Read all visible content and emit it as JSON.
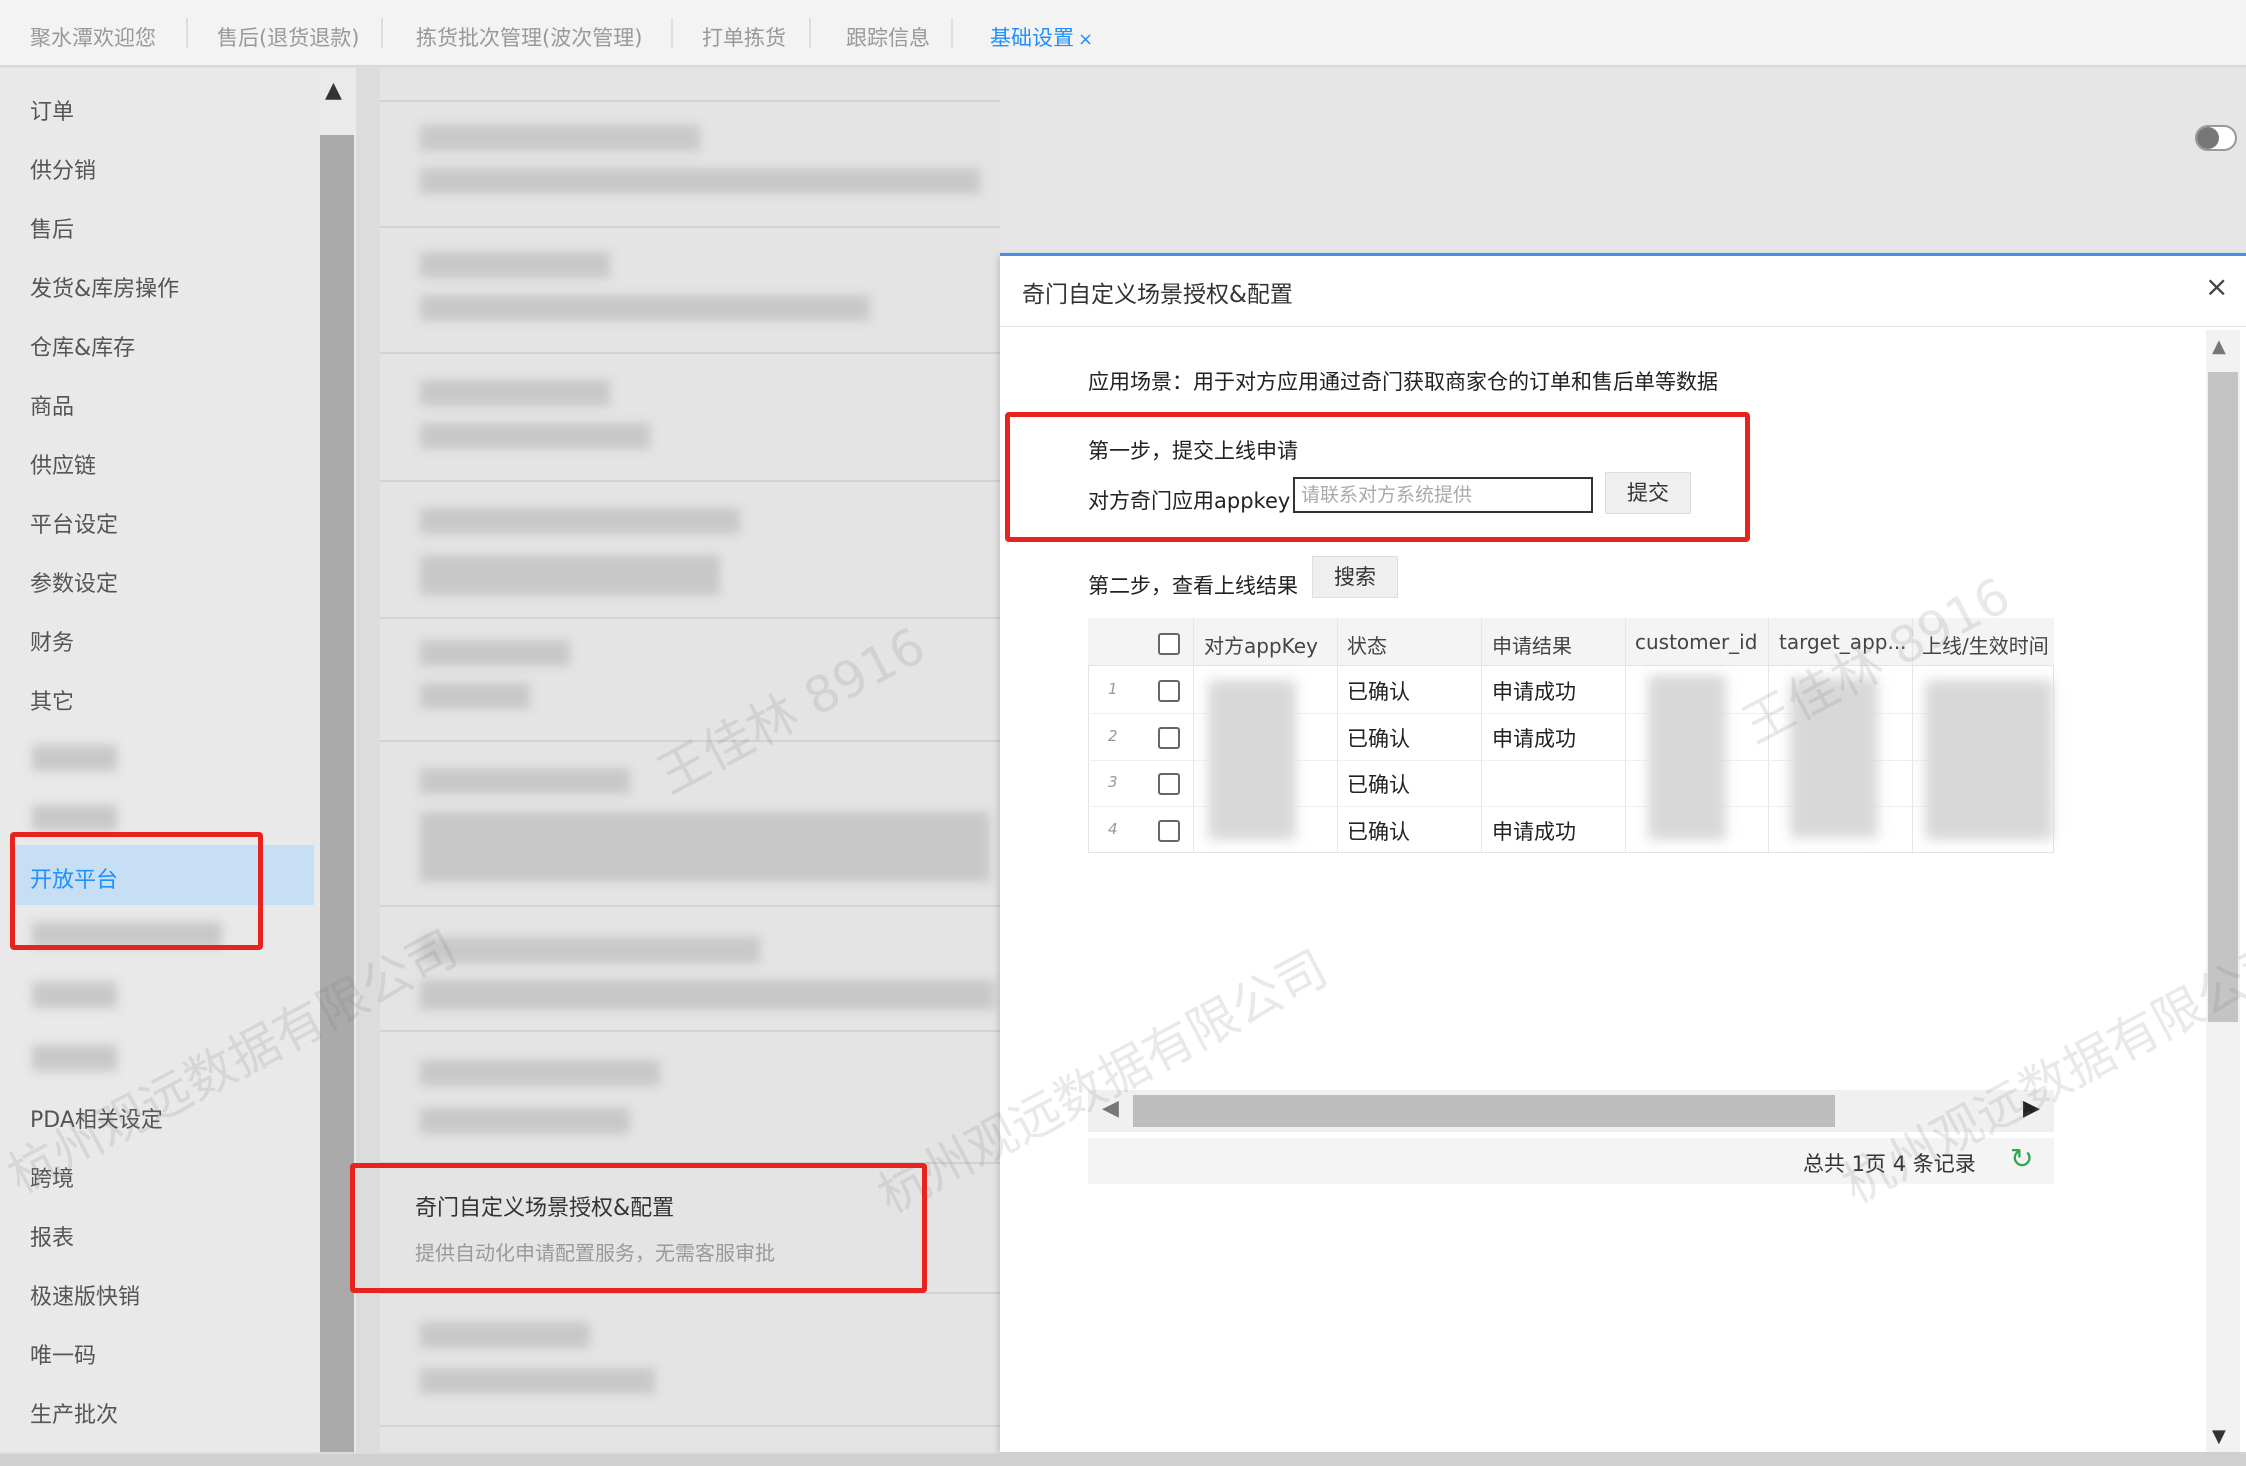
{
  "tabs": [
    {
      "label": "聚水潭欢迎您"
    },
    {
      "label": "售后(退货退款)"
    },
    {
      "label": "拣货批次管理(波次管理)"
    },
    {
      "label": "打单拣货"
    },
    {
      "label": "跟踪信息"
    },
    {
      "label": "基础设置",
      "close": "×"
    }
  ],
  "sidebar": {
    "items": [
      {
        "label": "订单"
      },
      {
        "label": "供分销"
      },
      {
        "label": "售后"
      },
      {
        "label": "发货&库房操作"
      },
      {
        "label": "仓库&库存"
      },
      {
        "label": "商品"
      },
      {
        "label": "供应链"
      },
      {
        "label": "平台设定"
      },
      {
        "label": "参数设定"
      },
      {
        "label": "财务"
      },
      {
        "label": "其它"
      },
      {
        "label": "开放平台"
      },
      {
        "label": "PDA相关设定"
      },
      {
        "label": "跨境"
      },
      {
        "label": "报表"
      },
      {
        "label": "极速版快销"
      },
      {
        "label": "唯一码"
      },
      {
        "label": "生产批次"
      }
    ]
  },
  "card": {
    "title": "奇门自定义场景授权&配置",
    "description": "提供自动化申请配置服务，无需客服审批"
  },
  "dialog": {
    "title": "奇门自定义场景授权&配置",
    "close": "×",
    "scene": "应用场景：用于对方应用通过奇门获取商家仓的订单和售后单等数据",
    "step1": "第一步，提交上线申请",
    "appkey_label": "对方奇门应用appkey",
    "appkey_placeholder": "请联系对方系统提供",
    "submit_label": "提交",
    "step2": "第二步，查看上线结果",
    "search_label": "搜索",
    "table": {
      "headers": [
        "对方appKey",
        "状态",
        "申请结果",
        "customer_id",
        "target_app...",
        "上线/生效时间"
      ],
      "rows": [
        {
          "no": "1",
          "status": "已确认",
          "result": "申请成功"
        },
        {
          "no": "2",
          "status": "已确认",
          "result": "申请成功"
        },
        {
          "no": "3",
          "status": "已确认",
          "result": ""
        },
        {
          "no": "4",
          "status": "已确认",
          "result": "申请成功"
        }
      ]
    },
    "pager": "总共 1页 4 条记录"
  },
  "watermark": {
    "name": "王佳林 8916",
    "company": "杭州观远数据有限公司"
  },
  "colors": {
    "accent": "#1e90ff",
    "highlight_box": "#e8231e",
    "refresh": "#2ea84d"
  },
  "icons": [
    "close-icon",
    "toggle-switch",
    "refresh-icon",
    "scroll-up-icon",
    "scroll-down-icon",
    "arrow-left-icon",
    "arrow-right-icon"
  ]
}
